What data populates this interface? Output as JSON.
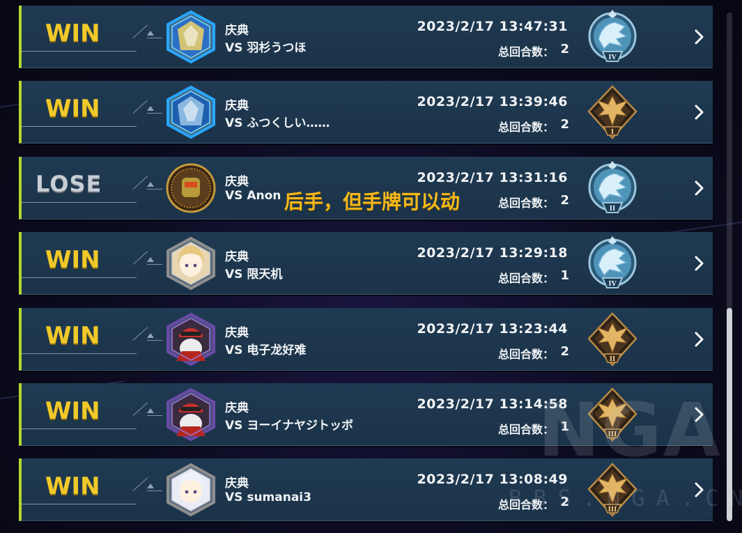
{
  "overlay_note": "后手，但手牌可以动",
  "turns_label": "总回合数：",
  "mode_label": "庆典",
  "watermark": {
    "brand": "NGA",
    "url": "BBS.NGA.CN"
  },
  "colors": {
    "win": "#f0c92a",
    "lose": "#c7ced4",
    "accent_bar": "#b6d72c",
    "row_bg": "#1f3a52"
  },
  "matches": [
    {
      "result": "WIN",
      "mode": "庆典",
      "opponent": "VS 羽杉うつほ",
      "datetime": "2023/2/17 13:47:31",
      "turns_label": "总回合数：",
      "turns": "2",
      "avatar": "mecha-card-avatar",
      "rank": {
        "tier": "platinum",
        "level": "IV"
      }
    },
    {
      "result": "WIN",
      "mode": "庆典",
      "opponent": "VS ふつくしい……",
      "datetime": "2023/2/17 13:39:46",
      "turns_label": "总回合数：",
      "turns": "2",
      "avatar": "dragon-card-avatar",
      "rank": {
        "tier": "gold",
        "level": "I"
      }
    },
    {
      "result": "LOSE",
      "mode": "庆典",
      "opponent": "VS Anon",
      "datetime": "2023/2/17 13:31:16",
      "turns_label": "总回合数：",
      "turns": "2",
      "avatar": "robot-emblem-avatar",
      "rank": {
        "tier": "platinum",
        "level": "II"
      }
    },
    {
      "result": "WIN",
      "mode": "庆典",
      "opponent": "VS 限天机",
      "datetime": "2023/2/17 13:29:18",
      "turns_label": "总回合数：",
      "turns": "1",
      "avatar": "blonde-girl-avatar",
      "rank": {
        "tier": "platinum",
        "level": "IV"
      }
    },
    {
      "result": "WIN",
      "mode": "庆典",
      "opponent": "VS 电子龙好难",
      "datetime": "2023/2/17 13:23:44",
      "turns_label": "总回合数：",
      "turns": "2",
      "avatar": "red-cap-duelist-avatar",
      "rank": {
        "tier": "gold",
        "level": "II"
      }
    },
    {
      "result": "WIN",
      "mode": "庆典",
      "opponent": "VS ヨーイナヤジトッボ",
      "datetime": "2023/2/17 13:14:58",
      "turns_label": "总回合数：",
      "turns": "1",
      "avatar": "red-cap-duelist-avatar",
      "rank": {
        "tier": "gold",
        "level": "III"
      }
    },
    {
      "result": "WIN",
      "mode": "庆典",
      "opponent": "VS sumanai3",
      "datetime": "2023/2/17 13:08:49",
      "turns_label": "总回合数：",
      "turns": "2",
      "avatar": "white-hair-girl-avatar",
      "rank": {
        "tier": "gold",
        "level": "III"
      }
    }
  ]
}
